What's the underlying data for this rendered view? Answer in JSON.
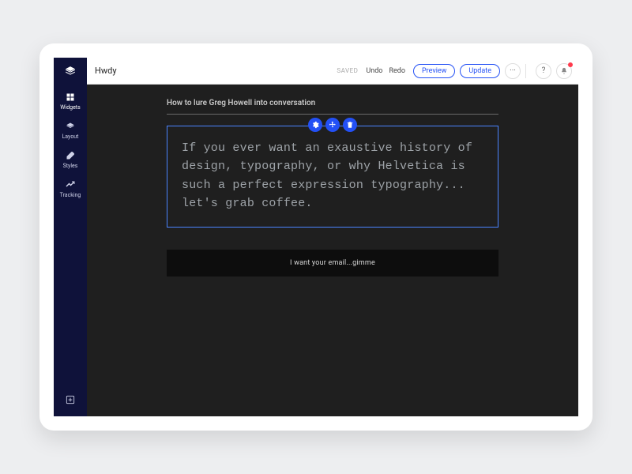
{
  "header": {
    "title": "Hwdy",
    "saved_label": "SAVED",
    "undo_label": "Undo",
    "redo_label": "Redo",
    "preview_label": "Preview",
    "update_label": "Update",
    "more_label": "···",
    "help_label": "?",
    "notifications_label": "🔔"
  },
  "sidebar": {
    "items": [
      {
        "label": "Widgets"
      },
      {
        "label": "Layout"
      },
      {
        "label": "Styles"
      },
      {
        "label": "Tracking"
      }
    ]
  },
  "canvas": {
    "heading": "How to lure Greg Howell into conversation",
    "body_text": "If you ever want an exaustive history of design, typography, or why Helvetica is such a perfect expression typography... let's grab coffee.",
    "cta_label": "I want your email...gimme"
  }
}
